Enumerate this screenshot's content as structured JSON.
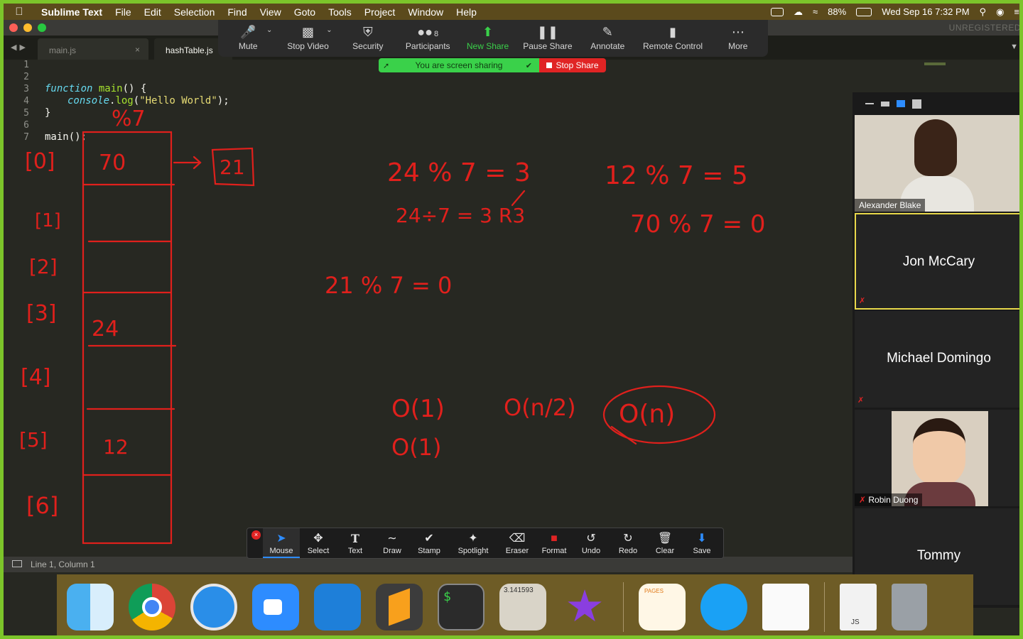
{
  "menubar": {
    "app": "Sublime Text",
    "items": [
      "File",
      "Edit",
      "Selection",
      "Find",
      "View",
      "Goto",
      "Tools",
      "Project",
      "Window",
      "Help"
    ],
    "battery": "88%",
    "datetime": "Wed Sep 16  7:32 PM"
  },
  "sublime": {
    "unregistered": "UNREGISTERED",
    "tabs": [
      "main.js",
      "hashTable.js"
    ],
    "lines": [
      "1",
      "2",
      "3",
      "4",
      "5",
      "6",
      "7"
    ],
    "code": {
      "l3_kw": "function",
      "l3_fn": "main",
      "l3_rest": "() {",
      "l4_obj": "console",
      "l4_dot": ".",
      "l4_fn": "log",
      "l4_open": "(",
      "l4_str": "\"Hello World\"",
      "l4_close": ");",
      "l5": "}",
      "l7": "main();"
    },
    "status": "Line 1, Column 1"
  },
  "zoom_toolbar": {
    "buttons": [
      "Mute",
      "Stop Video",
      "Security",
      "Participants",
      "New Share",
      "Pause Share",
      "Annotate",
      "Remote Control",
      "More"
    ],
    "participant_count": "8",
    "sharing_text": "You are screen sharing",
    "stop_share": "Stop Share"
  },
  "annotation_toolbar": {
    "tools": [
      "Mouse",
      "Select",
      "Text",
      "Draw",
      "Stamp",
      "Spotlight",
      "Eraser",
      "Format",
      "Undo",
      "Redo",
      "Clear",
      "Save"
    ]
  },
  "participants": [
    {
      "name": "Alexander Blake",
      "video": true
    },
    {
      "name": "Jon McCary",
      "video": false
    },
    {
      "name": "Michael Domingo",
      "video": false
    },
    {
      "name": "Robin Duong",
      "video": true
    },
    {
      "name": "Tommy",
      "video": false
    }
  ],
  "annotations": {
    "index_labels": [
      "[0]",
      "[1]",
      "[2]",
      "[3]",
      "[4]",
      "[5]",
      "[6]"
    ],
    "cells": [
      "70",
      "",
      "",
      "24",
      "",
      "12",
      ""
    ],
    "over_log": "%7",
    "collision_box": "21",
    "notes": [
      "24 % 7 = 3",
      "24÷7 = 3 R3",
      "12 % 7 = 5",
      "70 % 7 = 0",
      "21 % 7 = 0",
      "O(1)",
      "O(1)",
      "O(n/2)",
      "O(n)"
    ]
  },
  "dock": {
    "calculator_display": "3.141593",
    "pages_label": "PAGES",
    "file_label": "JS"
  },
  "colors": {
    "ink": "#e0201c",
    "zoom_green": "#3ad14a",
    "zoom_red": "#e02424",
    "accent_blue": "#2d8cff"
  }
}
